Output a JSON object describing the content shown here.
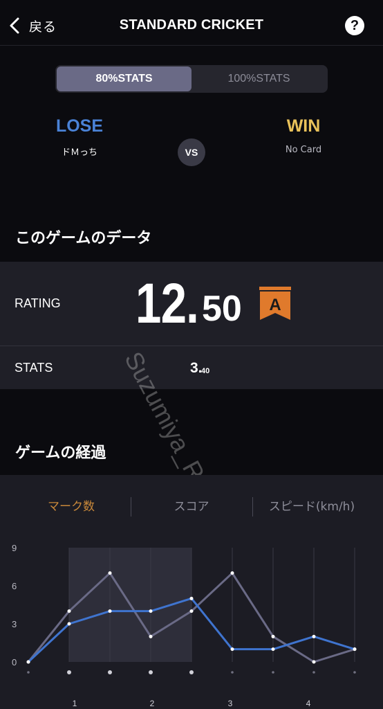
{
  "header": {
    "back_label": "戻る",
    "title": "STANDARD CRICKET",
    "help_label": "?"
  },
  "stats_toggle": {
    "options": [
      "80%STATS",
      "100%STATS"
    ],
    "selected": "80%STATS"
  },
  "result": {
    "left": {
      "outcome": "LOSE",
      "player": "ドＭっち"
    },
    "right": {
      "outcome": "WIN",
      "player": "No Card"
    },
    "vs_label": "VS"
  },
  "game_data": {
    "section_title": "このゲームのデータ",
    "rating_label": "RATING",
    "rating_int": "12.",
    "rating_dec": "50",
    "rating_grade": "A",
    "stats_label": "STATS",
    "stats_int": "3.",
    "stats_dec": "40"
  },
  "progress": {
    "section_title": "ゲームの経過",
    "tabs": [
      "マーク数",
      "スコア",
      "スピード(km/h)"
    ],
    "selected_tab": "マーク数"
  },
  "watermark": "Suzumiya_Ruan",
  "colors": {
    "accent_blue": "#4a82d6",
    "accent_gold": "#e9c25a",
    "grade_orange": "#e07a2c",
    "series_blue": "#3f74cf",
    "series_gray": "#6a6a86"
  },
  "chart_data": {
    "type": "line",
    "x": [
      0,
      1,
      2,
      3,
      4,
      5,
      6,
      7,
      8
    ],
    "round_labels": [
      "1",
      "2",
      "3",
      "4"
    ],
    "y_ticks": [
      "9",
      "6",
      "3",
      "0"
    ],
    "ylim": [
      0,
      9
    ],
    "series": [
      {
        "values": [
          0,
          4,
          7,
          2,
          4,
          7,
          2,
          0,
          1
        ]
      },
      {
        "values": [
          0,
          3,
          4,
          4,
          5,
          1,
          1,
          2,
          1
        ]
      }
    ],
    "highlight_range": [
      1,
      4
    ],
    "grid": true
  }
}
